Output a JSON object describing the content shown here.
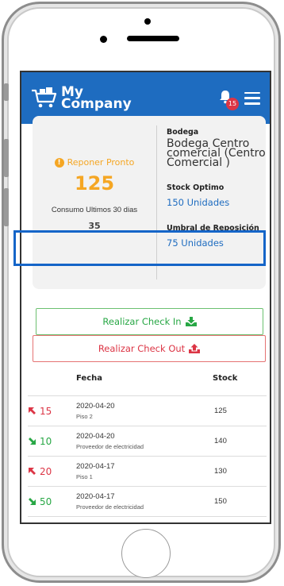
{
  "header": {
    "brand_line1": "My",
    "brand_line2": "Company",
    "notification_count": "15"
  },
  "summary": {
    "reponer_label": "Reponer Pronto",
    "reponer_value": "125",
    "consumo_label": "Consumo Ultimos 30 dias",
    "consumo_value": "35",
    "bodega_label": "Bodega",
    "bodega_value": "Bodega Centro comercial (Centro Comercial )",
    "stock_optimo_label": "Stock Optimo",
    "stock_optimo_value": "150 Unidades",
    "umbral_label": "Umbral de Reposición",
    "umbral_value": "75 Unidades"
  },
  "actions": {
    "checkin_label": "Realizar Check In",
    "checkout_label": "Realizar Check Out"
  },
  "table": {
    "headers": [
      "",
      "Fecha",
      "Stock"
    ],
    "rows": [
      {
        "direction": "out",
        "qty": "15",
        "date": "2020-04-20",
        "location": "Piso 2",
        "stock": "125"
      },
      {
        "direction": "in",
        "qty": "10",
        "date": "2020-04-20",
        "location": "Proveedor de electricidad",
        "stock": "140"
      },
      {
        "direction": "out",
        "qty": "20",
        "date": "2020-04-17",
        "location": "Piso 1",
        "stock": "130"
      },
      {
        "direction": "in",
        "qty": "50",
        "date": "2020-04-17",
        "location": "Proveedor de electricidad",
        "stock": "150"
      }
    ]
  },
  "colors": {
    "primary": "#1e6cc0",
    "warning": "#f5a623",
    "success": "#28a745",
    "danger": "#dc3545"
  }
}
